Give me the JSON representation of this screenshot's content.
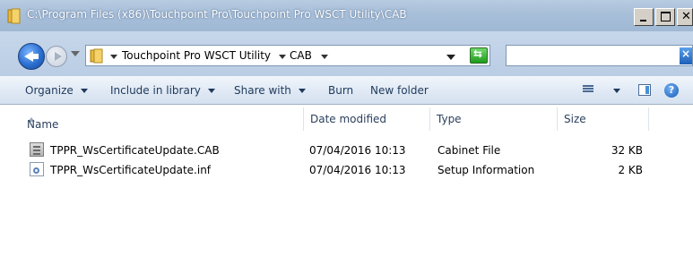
{
  "window": {
    "title": "C:\\Program Files (x86)\\Touchpoint Pro\\Touchpoint Pro WSCT Utility\\CAB"
  },
  "address_bar": {
    "breadcrumbs": [
      "Touchpoint Pro WSCT Utility",
      "CAB"
    ]
  },
  "search": {
    "value": "",
    "placeholder": ""
  },
  "toolbar": {
    "organize": "Organize",
    "include_in_library": "Include in library",
    "share_with": "Share with",
    "burn": "Burn",
    "new_folder": "New folder"
  },
  "columns": [
    "Name",
    "Date modified",
    "Type",
    "Size"
  ],
  "files": [
    {
      "name": "TPPR_WsCertificateUpdate.CAB",
      "date": "07/04/2016 10:13",
      "type": "Cabinet File",
      "size": "32 KB",
      "icon": "cabinet-file-icon"
    },
    {
      "name": "TPPR_WsCertificateUpdate.inf",
      "date": "07/04/2016 10:13",
      "type": "Setup Information",
      "size": "2 KB",
      "icon": "setup-information-file-icon"
    }
  ],
  "colors": {
    "title_bar": "#a8bfd9",
    "command_bar": "#e1eaf5",
    "header_text": "#2b3f5c"
  }
}
